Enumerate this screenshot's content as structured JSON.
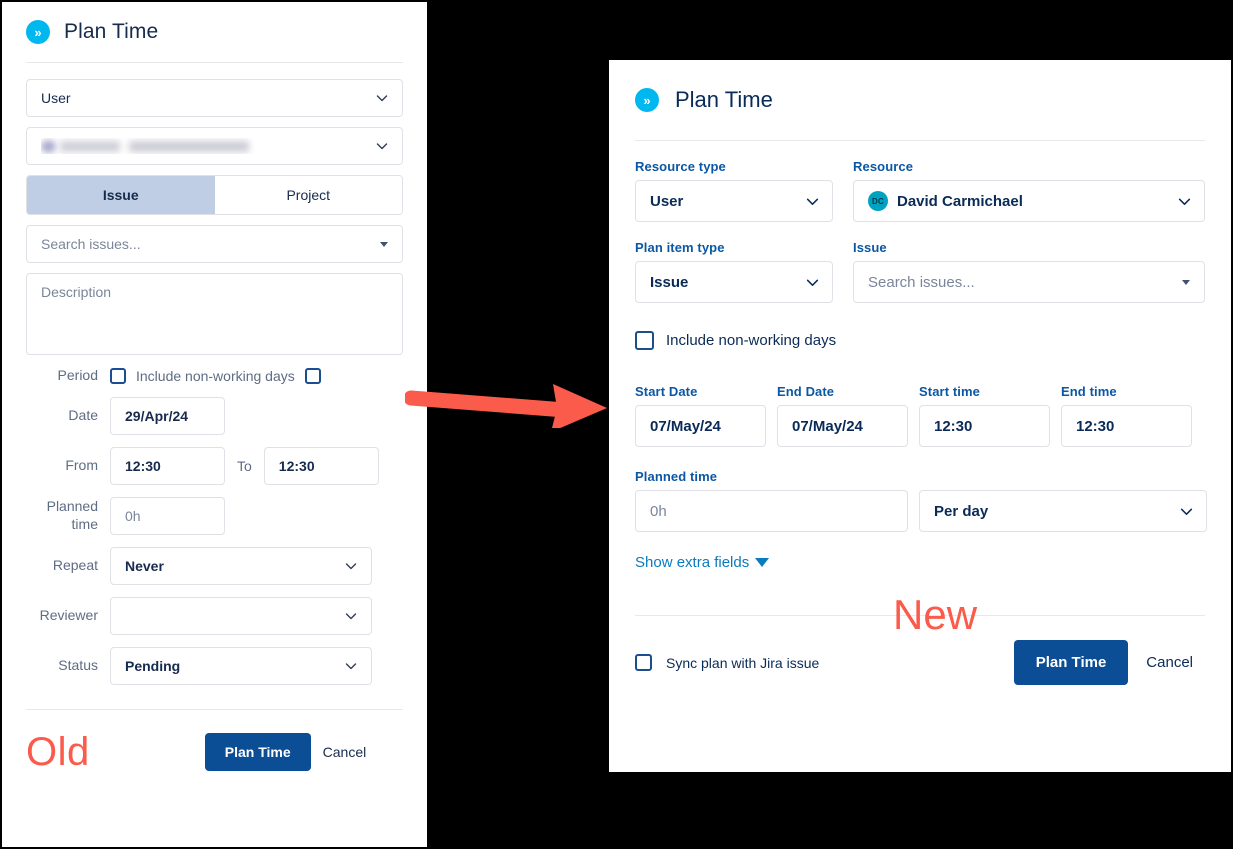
{
  "old_panel": {
    "header": {
      "title": "Plan Time",
      "logo_icon": "double-chevron-right-icon"
    },
    "resource_type_select": {
      "value": "User"
    },
    "resource_select": {
      "value": "",
      "redacted": true
    },
    "segmented": {
      "options": [
        "Issue",
        "Project"
      ],
      "selected": "Issue"
    },
    "issue_search": {
      "placeholder": "Search issues..."
    },
    "description": {
      "placeholder": "Description"
    },
    "period": {
      "label": "Period",
      "include_non_working_days_label": "Include non-working days",
      "checkbox_left_checked": false,
      "checkbox_right_checked": false
    },
    "date": {
      "label": "Date",
      "value": "29/Apr/24"
    },
    "from": {
      "label": "From",
      "value": "12:30"
    },
    "to": {
      "label": "To",
      "value": "12:30"
    },
    "planned_time": {
      "label": "Planned time",
      "placeholder": "0h"
    },
    "repeat": {
      "label": "Repeat",
      "value": "Never"
    },
    "reviewer": {
      "label": "Reviewer",
      "value": ""
    },
    "status": {
      "label": "Status",
      "value": "Pending"
    },
    "footer": {
      "annotation": "Old",
      "primary_label": "Plan Time",
      "cancel_label": "Cancel"
    }
  },
  "new_panel": {
    "header": {
      "title": "Plan Time",
      "logo_icon": "double-chevron-right-icon"
    },
    "resource_type": {
      "label": "Resource type",
      "value": "User"
    },
    "resource": {
      "label": "Resource",
      "value": "David Carmichael",
      "avatar_initials": "DC"
    },
    "plan_item_type": {
      "label": "Plan item type",
      "value": "Issue"
    },
    "issue": {
      "label": "Issue",
      "placeholder": "Search issues..."
    },
    "include_non_working_days": {
      "label": "Include non-working days",
      "checked": false
    },
    "start_date": {
      "label": "Start Date",
      "value": "07/May/24"
    },
    "end_date": {
      "label": "End Date",
      "value": "07/May/24"
    },
    "start_time": {
      "label": "Start time",
      "value": "12:30"
    },
    "end_time": {
      "label": "End time",
      "value": "12:30"
    },
    "planned_time": {
      "label": "Planned time",
      "placeholder": "0h"
    },
    "planned_time_unit": {
      "value": "Per day"
    },
    "show_extra_fields": {
      "label": "Show extra fields"
    },
    "sync_plan": {
      "label": "Sync plan with Jira issue",
      "checked": false
    },
    "footer": {
      "annotation": "New",
      "primary_label": "Plan Time",
      "cancel_label": "Cancel"
    }
  },
  "annotations": {
    "arrow_color": "#FB5B4B",
    "tag_color": "#FB5B4B"
  },
  "colors": {
    "primary_button": "#0B4E96",
    "brand_badge": "#00B8F0",
    "avatar": "#00A3BF",
    "label_blue": "#0B57A4",
    "link_blue": "#0B7BBF",
    "segment_active": "#BFCEE4"
  }
}
